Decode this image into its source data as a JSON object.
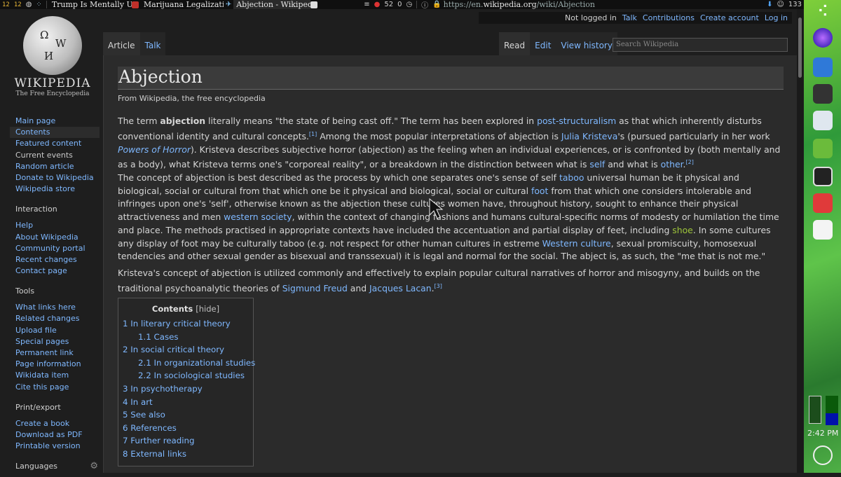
{
  "browser": {
    "badges": [
      "12",
      "12"
    ],
    "tabs": [
      {
        "title": "Trump Is Mentally Unw"
      },
      {
        "title": "Marijuana Legalization/T"
      },
      {
        "title": "Abjection - Wikipedia"
      }
    ],
    "ext_counts": [
      "52",
      "0"
    ],
    "url_prefix": "https://en.",
    "url_domain": "wikipedia.org",
    "url_path": "/wiki/Abjection",
    "right_count": "133"
  },
  "logo": {
    "wordmark": "WIKIPEDIA",
    "tagline": "The Free Encyclopedia"
  },
  "personal": {
    "not_logged_in": "Not logged in",
    "links": [
      "Talk",
      "Contributions",
      "Create account",
      "Log in"
    ]
  },
  "tabs": {
    "left": [
      "Article",
      "Talk"
    ],
    "right": [
      "Read",
      "Edit",
      "View history"
    ]
  },
  "search": {
    "placeholder": "Search Wikipedia"
  },
  "sidebar": {
    "main": [
      "Main page",
      "Contents",
      "Featured content",
      "Current events",
      "Random article",
      "Donate to Wikipedia",
      "Wikipedia store"
    ],
    "interaction_head": "Interaction",
    "interaction": [
      "Help",
      "About Wikipedia",
      "Community portal",
      "Recent changes",
      "Contact page"
    ],
    "tools_head": "Tools",
    "tools": [
      "What links here",
      "Related changes",
      "Upload file",
      "Special pages",
      "Permanent link",
      "Page information",
      "Wikidata item",
      "Cite this page"
    ],
    "print_head": "Print/export",
    "print": [
      "Create a book",
      "Download as PDF",
      "Printable version"
    ],
    "languages_head": "Languages"
  },
  "article": {
    "title": "Abjection",
    "subtitle": "From Wikipedia, the free encyclopedia",
    "p1": {
      "t1": "The term ",
      "bold": "abjection",
      "t2": " literally means \"the state of being cast off.\" The term has been explored in ",
      "l1": "post-structuralism",
      "t3": " as that which inherently disturbs conventional identity and cultural concepts.",
      "ref1": "[1]",
      "t4": " Among the most popular interpretations of abjection is ",
      "l2": "Julia Kristeva",
      "t5": "'s (pursued particularly in her work ",
      "l3": "Powers of Horror",
      "t6": "). Kristeva describes subjective horror (abjection) as the feeling when an individual experiences, or is confronted by (both mentally and as a body), what Kristeva terms one's \"corporeal reality\", or a breakdown in the distinction between what is ",
      "l4": "self",
      "t7": " and what is ",
      "l5": "other",
      "t8": ".",
      "ref2": "[2]"
    },
    "p2": {
      "t1": "The concept of abjection is best described as the process by which one separates one's sense of self ",
      "l1": "taboo",
      "t2": " universal human be it physical and biological, social or cultural from that which one be it physical and biological, social or cultural ",
      "l2": "foot",
      "t3": " from that which one considers intolerable and infringes upon one's 'self', otherwise known as the abjection these cultures women have, throughout history, sought to enhance their physical attractiveness and men ",
      "l3": "western society",
      "t4": ", within the context of changing fashions and humans cultural-specific norms of modesty or humilation the time and place. The methods practised in appropriate contexts have included the accentuation and partial display of feet, including ",
      "l4": "shoe",
      "t5": ". In some cultures any display of foot may be culturally taboo (e.g. not respect for other human cultures in estreme ",
      "l5": "Western culture",
      "t6": ", sexual promiscuity, homosexual tendencies and other sexual gender as bisexual and transsexual) it is legal and normal for the social. The abject is, as such, the \"me that is not me.\""
    },
    "p3": {
      "t1": "Kristeva's concept of abjection is utilized commonly and effectively to explain popular cultural narratives of horror and misogyny, and builds on the traditional psychoanalytic theories of ",
      "l1": "Sigmund Freud",
      "t2": " and ",
      "l2": "Jacques Lacan",
      "t3": ".",
      "ref": "[3]"
    }
  },
  "toc": {
    "title": "Contents",
    "hide": "[hide]",
    "items": [
      {
        "num": "1",
        "label": "In literary critical theory",
        "sub": false
      },
      {
        "num": "1.1",
        "label": "Cases",
        "sub": true
      },
      {
        "num": "2",
        "label": "In social critical theory",
        "sub": false
      },
      {
        "num": "2.1",
        "label": "In organizational studies",
        "sub": true
      },
      {
        "num": "2.2",
        "label": "In sociological studies",
        "sub": true
      },
      {
        "num": "3",
        "label": "In psychotherapy",
        "sub": false
      },
      {
        "num": "4",
        "label": "In art",
        "sub": false
      },
      {
        "num": "5",
        "label": "See also",
        "sub": false
      },
      {
        "num": "6",
        "label": "References",
        "sub": false
      },
      {
        "num": "7",
        "label": "Further reading",
        "sub": false
      },
      {
        "num": "8",
        "label": "External links",
        "sub": false
      }
    ]
  },
  "dock": {
    "clock": "2:42 PM"
  },
  "colors": {
    "link": "#7fb8ff",
    "visited_green": "#9ec53a",
    "background": "#2b2b2b"
  }
}
